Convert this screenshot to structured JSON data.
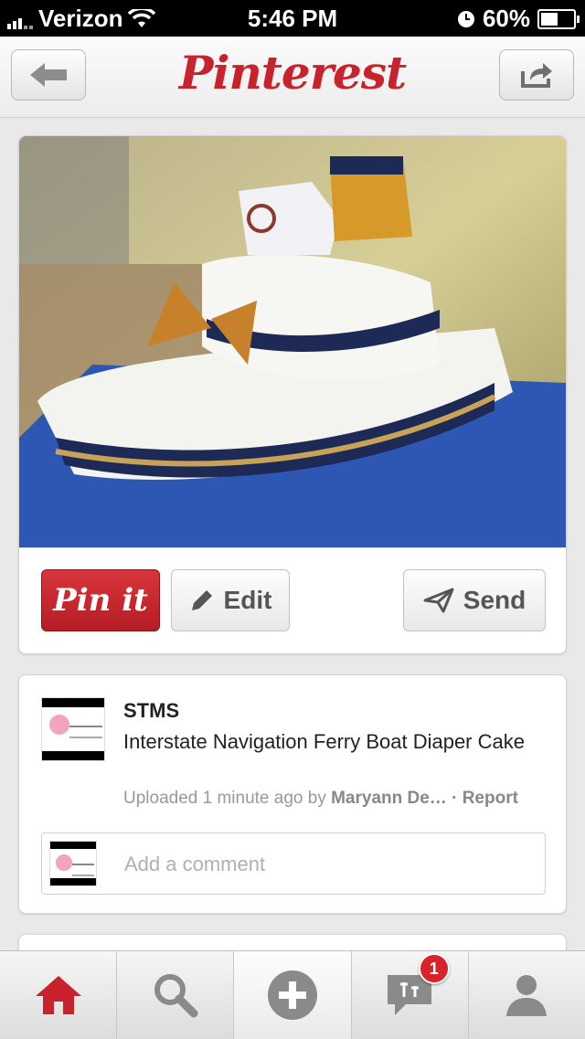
{
  "status_bar": {
    "carrier": "Verizon",
    "time": "5:46 PM",
    "battery": "60%",
    "battery_level": 0.6
  },
  "nav": {
    "logo": "Pinterest"
  },
  "pin": {
    "pin_it_label": "Pin it",
    "edit_label": "Edit",
    "send_label": "Send"
  },
  "details": {
    "board": "STMS",
    "description": "Interstate Navigation Ferry Boat Diaper Cake",
    "uploaded": "Uploaded 1 minute ago by",
    "user": "Maryann De…",
    "report": "· Report",
    "comment_placeholder": "Add a comment"
  },
  "tabbar": {
    "notification_count": "1"
  },
  "colors": {
    "brand": "#c8232c",
    "home_active": "#c8232c",
    "tab_icon": "#8a8a8a"
  }
}
